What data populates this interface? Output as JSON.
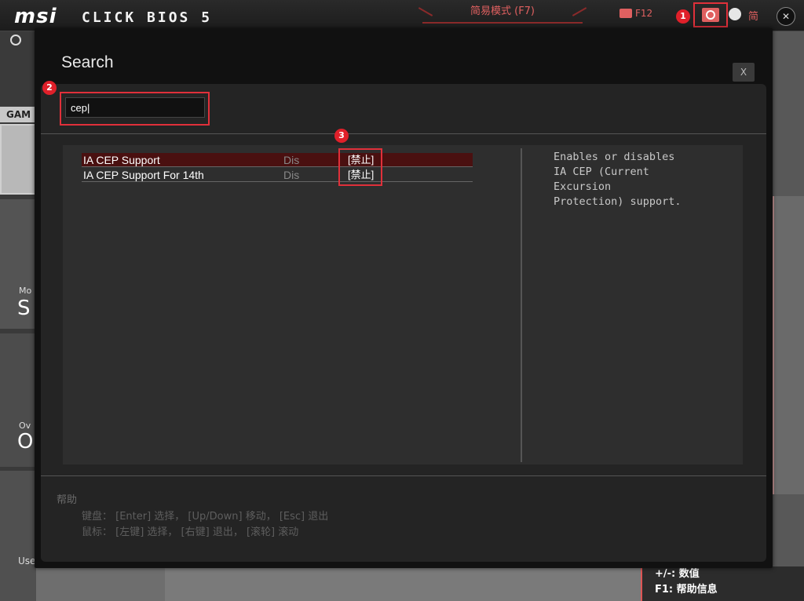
{
  "topbar": {
    "logo": "msi",
    "product": "CLICK BIOS 5",
    "ez_mode": "简易模式 (F7)",
    "screenshot_key": "F12",
    "language": "简",
    "icons": [
      "clock-icon",
      "camera-icon",
      "search-icon",
      "globe-icon",
      "exit-icon"
    ]
  },
  "background": {
    "game_label": "GAM",
    "mo_label": "Mo",
    "s_label": "S",
    "ov_label": "Ov",
    "o_label": "O",
    "use_label": "Use",
    "help_right": [
      "+/-:  数值",
      "F1:  帮助信息"
    ]
  },
  "annotations": [
    "1",
    "2",
    "3"
  ],
  "modal": {
    "title": "Search",
    "close_label": "X",
    "search": {
      "value": "cep|"
    },
    "results": [
      {
        "name": "IA CEP Support",
        "value": "Dis",
        "option": "[禁止]",
        "selected": true
      },
      {
        "name": "IA CEP Support For 14th",
        "value": "Dis",
        "option": "[禁止]",
        "selected": false
      }
    ],
    "description": [
      "Enables or disables",
      "IA CEP (Current",
      "Excursion",
      "Protection) support."
    ],
    "help": {
      "title": "帮助",
      "keyboard": "键盘： [Enter] 选择， [Up/Down] 移动， [Esc] 退出",
      "mouse": "鼠标： [左键] 选择， [右键] 退出， [滚轮] 滚动"
    }
  },
  "colors": {
    "accent": "#e0303a",
    "ez_text": "#e06060",
    "selected_row": "#4a1010"
  }
}
